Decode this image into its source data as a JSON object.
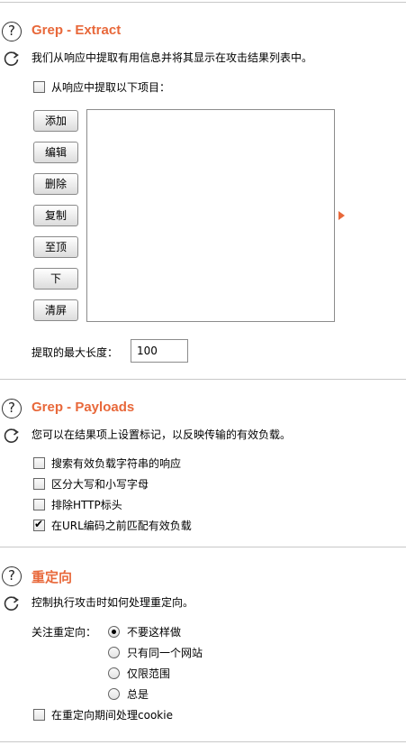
{
  "extract": {
    "title": "Grep - Extract",
    "description": "我们从响应中提取有用信息并将其显示在攻击结果列表中。",
    "checkbox_label": "从响应中提取以下项目：",
    "checkbox_checked": false,
    "buttons": [
      "添加",
      "编辑",
      "删除",
      "复制",
      "至顶",
      "下",
      "清屏"
    ],
    "max_length_label": "提取的最大长度：",
    "max_length_value": "100"
  },
  "payloads": {
    "title": "Grep - Payloads",
    "description": "您可以在结果项上设置标记，以反映传输的有效负载。",
    "options": [
      {
        "label": "搜索有效负载字符串的响应",
        "checked": false
      },
      {
        "label": "区分大写和小写字母",
        "checked": false
      },
      {
        "label": "排除HTTP标头",
        "checked": false
      },
      {
        "label": "在URL编码之前匹配有效负载",
        "checked": true
      }
    ]
  },
  "redirect": {
    "title": "重定向",
    "description": "控制执行攻击时如何处理重定向。",
    "follow_label": "关注重定向：",
    "radios": [
      {
        "label": "不要这样做",
        "selected": true
      },
      {
        "label": "只有同一个网站",
        "selected": false
      },
      {
        "label": "仅限范围",
        "selected": false
      },
      {
        "label": "总是",
        "selected": false
      }
    ],
    "cookie_label": "在重定向期间处理cookie",
    "cookie_checked": false
  },
  "icons": {
    "help": "?",
    "accent_color": "#e8683a"
  }
}
